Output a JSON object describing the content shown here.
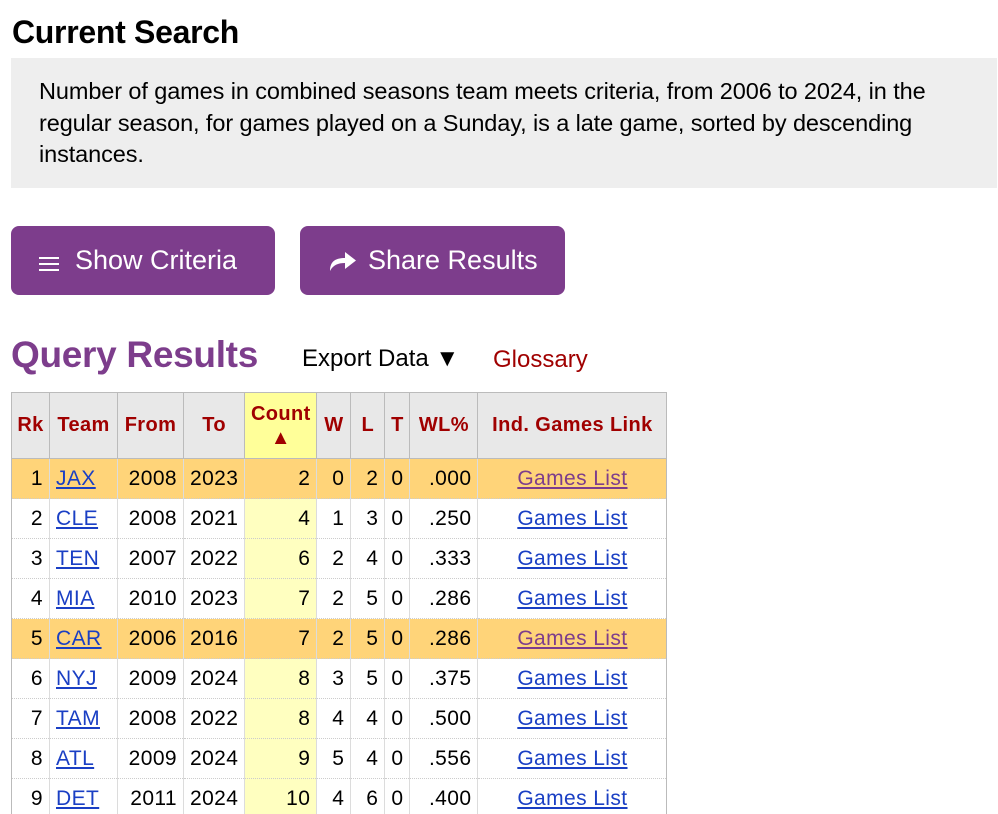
{
  "header": {
    "title": "Current Search",
    "criteria_text": "Number of games in combined seasons team meets criteria, from 2006 to 2024, in the regular season, for games played on a Sunday, is a late game, sorted by descending instances."
  },
  "buttons": {
    "show_criteria": "Show Criteria",
    "share_results": "Share Results"
  },
  "results": {
    "title": "Query Results",
    "export_label": "Export Data ▼",
    "glossary_label": "Glossary",
    "columns": {
      "rk": "Rk",
      "team": "Team",
      "from": "From",
      "to": "To",
      "count": "Count",
      "count_sort": "▲",
      "w": "W",
      "l": "L",
      "t": "T",
      "wlpct": "WL%",
      "link": "Ind. Games Link"
    },
    "rows": [
      {
        "rk": "1",
        "team": "JAX",
        "from": "2008",
        "to": "2023",
        "count": "2",
        "w": "0",
        "l": "2",
        "t": "0",
        "wlpct": ".000",
        "link": "Games List",
        "highlight": true
      },
      {
        "rk": "2",
        "team": "CLE",
        "from": "2008",
        "to": "2021",
        "count": "4",
        "w": "1",
        "l": "3",
        "t": "0",
        "wlpct": ".250",
        "link": "Games List",
        "highlight": false
      },
      {
        "rk": "3",
        "team": "TEN",
        "from": "2007",
        "to": "2022",
        "count": "6",
        "w": "2",
        "l": "4",
        "t": "0",
        "wlpct": ".333",
        "link": "Games List",
        "highlight": false
      },
      {
        "rk": "4",
        "team": "MIA",
        "from": "2010",
        "to": "2023",
        "count": "7",
        "w": "2",
        "l": "5",
        "t": "0",
        "wlpct": ".286",
        "link": "Games List",
        "highlight": false
      },
      {
        "rk": "5",
        "team": "CAR",
        "from": "2006",
        "to": "2016",
        "count": "7",
        "w": "2",
        "l": "5",
        "t": "0",
        "wlpct": ".286",
        "link": "Games List",
        "highlight": true
      },
      {
        "rk": "6",
        "team": "NYJ",
        "from": "2009",
        "to": "2024",
        "count": "8",
        "w": "3",
        "l": "5",
        "t": "0",
        "wlpct": ".375",
        "link": "Games List",
        "highlight": false
      },
      {
        "rk": "7",
        "team": "TAM",
        "from": "2008",
        "to": "2022",
        "count": "8",
        "w": "4",
        "l": "4",
        "t": "0",
        "wlpct": ".500",
        "link": "Games List",
        "highlight": false
      },
      {
        "rk": "8",
        "team": "ATL",
        "from": "2009",
        "to": "2024",
        "count": "9",
        "w": "5",
        "l": "4",
        "t": "0",
        "wlpct": ".556",
        "link": "Games List",
        "highlight": false
      },
      {
        "rk": "9",
        "team": "DET",
        "from": "2011",
        "to": "2024",
        "count": "10",
        "w": "4",
        "l": "6",
        "t": "0",
        "wlpct": ".400",
        "link": "Games List",
        "highlight": false
      }
    ]
  },
  "icons": {
    "show_criteria": "hamburger-menu-icon",
    "share_results": "share-arrow-icon"
  },
  "colors": {
    "brand_purple": "#7d3d8c",
    "header_red": "#a00000",
    "highlight_row": "#ffd479",
    "sorted_column": "#ffffc0",
    "link_blue": "#1a3fc4"
  }
}
